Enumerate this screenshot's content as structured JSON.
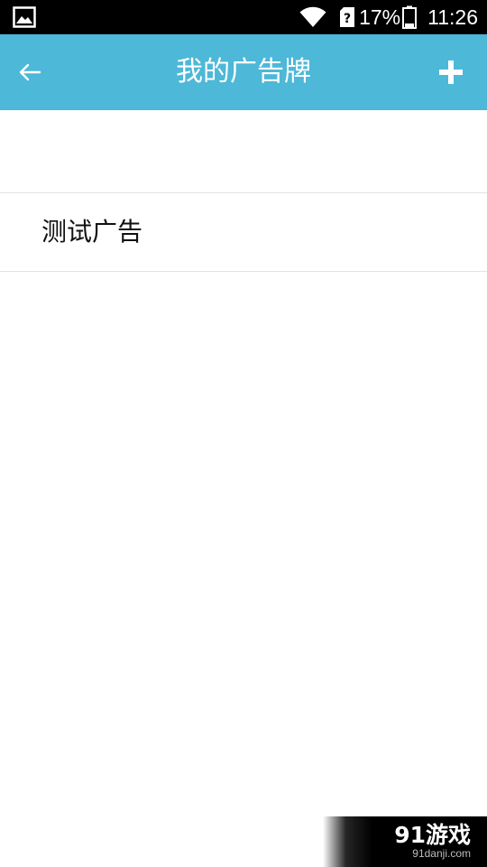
{
  "status_bar": {
    "battery_percent": "17%",
    "time": "11:26",
    "icons": [
      "gallery-icon",
      "wifi-icon",
      "sim-unknown-icon",
      "battery-icon"
    ]
  },
  "app_bar": {
    "title": "我的广告牌",
    "back_icon": "arrow-left-icon",
    "add_icon": "plus-icon",
    "background_color": "#4db8d7"
  },
  "list": {
    "items": [
      {
        "label": "测试广告"
      }
    ]
  },
  "watermark": {
    "logo_text": "91游戏",
    "site": "91danji.com"
  }
}
